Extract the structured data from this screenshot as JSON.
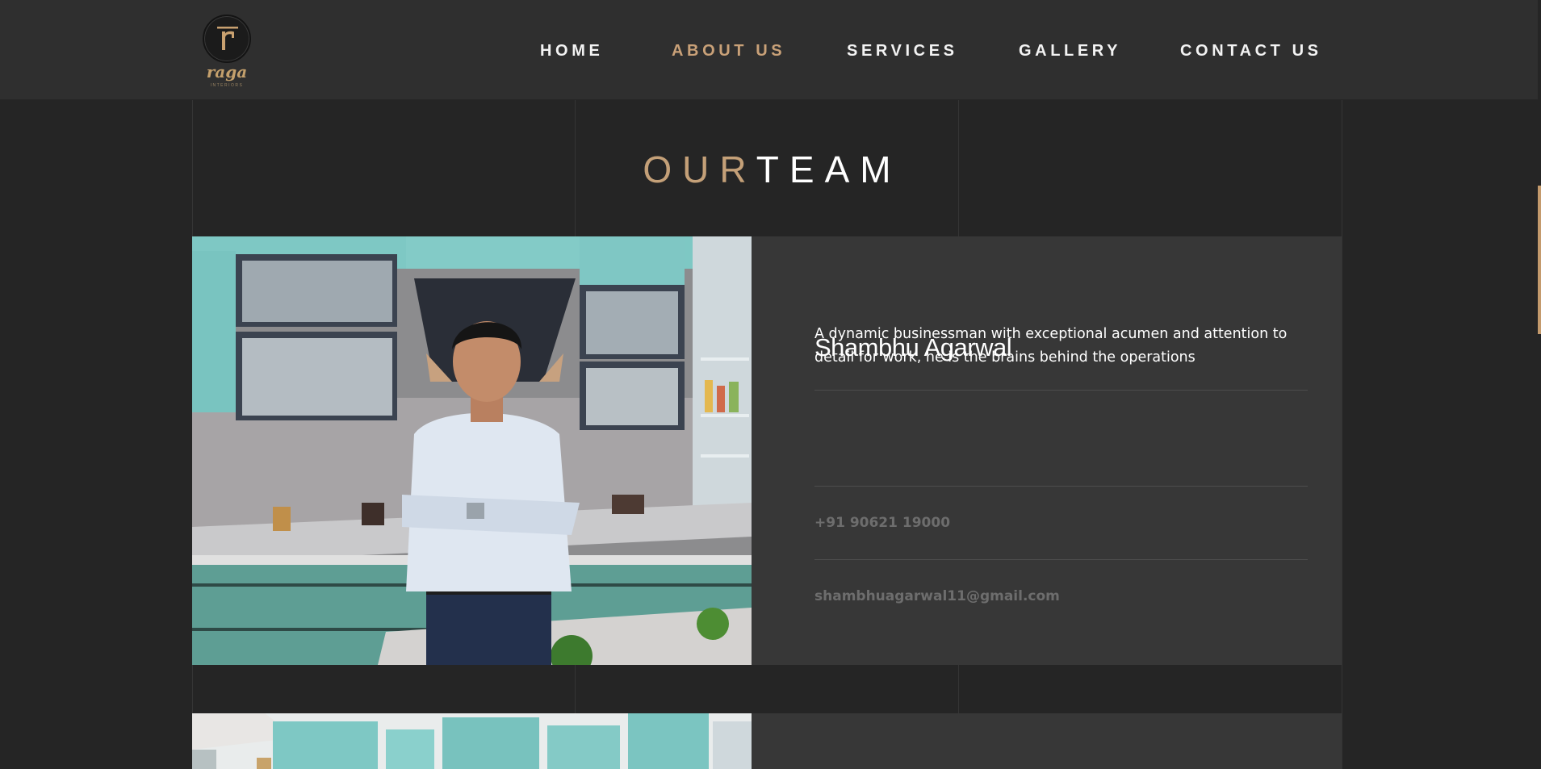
{
  "header": {
    "logo": {
      "mark": "r",
      "wordmark": "raga",
      "tagline": "INTERIORS"
    },
    "nav": [
      {
        "label": "HOME",
        "active": false
      },
      {
        "label": "ABOUT US",
        "active": true
      },
      {
        "label": "SERVICES",
        "active": false
      },
      {
        "label": "GALLERY",
        "active": false
      },
      {
        "label": "CONTACT US",
        "active": false
      }
    ]
  },
  "section": {
    "title_accent": "OUR",
    "title_main": "TEAM"
  },
  "team": [
    {
      "name": "Shambhu Agarwal",
      "bio": "A dynamic businessman with exceptional acumen and attention to detail for work, he is the brains behind the operations",
      "phone": "+91 90621 19000",
      "email": "shambhuagarwal11@gmail.com"
    }
  ],
  "colors": {
    "accent": "#c4a078",
    "background": "#252525",
    "header": "#2f2f2f",
    "card": "#373737",
    "muted_text": "#6d6d6d"
  }
}
